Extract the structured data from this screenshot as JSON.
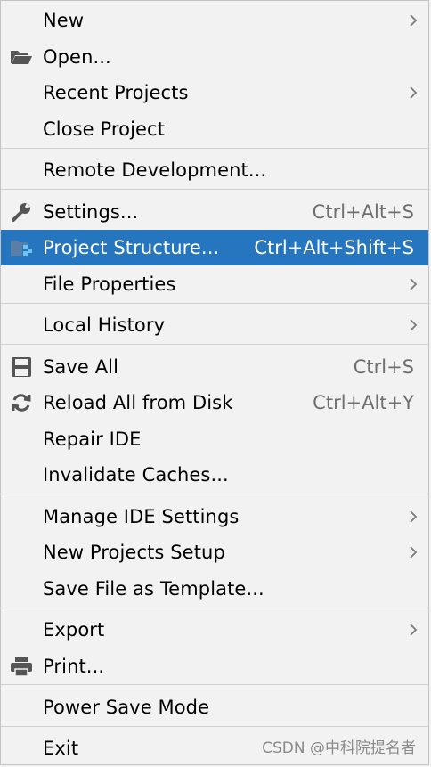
{
  "menu": {
    "items": {
      "new": {
        "label": "New"
      },
      "open": {
        "label": "Open..."
      },
      "recent_projects": {
        "label": "Recent Projects"
      },
      "close_project": {
        "label": "Close Project"
      },
      "remote_development": {
        "label": "Remote Development..."
      },
      "settings": {
        "label": "Settings...",
        "shortcut": "Ctrl+Alt+S"
      },
      "project_structure": {
        "label": "Project Structure...",
        "shortcut": "Ctrl+Alt+Shift+S"
      },
      "file_properties": {
        "label": "File Properties"
      },
      "local_history": {
        "label": "Local History"
      },
      "save_all": {
        "label": "Save All",
        "shortcut": "Ctrl+S"
      },
      "reload_all": {
        "label": "Reload All from Disk",
        "shortcut": "Ctrl+Alt+Y"
      },
      "repair_ide": {
        "label": "Repair IDE"
      },
      "invalidate_caches": {
        "label": "Invalidate Caches..."
      },
      "manage_ide_settings": {
        "label": "Manage IDE Settings"
      },
      "new_projects_setup": {
        "label": "New Projects Setup"
      },
      "save_file_as_template": {
        "label": "Save File as Template..."
      },
      "export": {
        "label": "Export"
      },
      "print": {
        "label": "Print..."
      },
      "power_save_mode": {
        "label": "Power Save Mode"
      },
      "exit": {
        "label": "Exit"
      }
    },
    "selected_item": "Project Structure..."
  },
  "watermark": "CSDN @中科院提名者",
  "colors": {
    "selection": "#2675bf",
    "background": "#f2f2f2",
    "separator": "#d1d1d1",
    "shortcut": "#6e6e6e"
  }
}
